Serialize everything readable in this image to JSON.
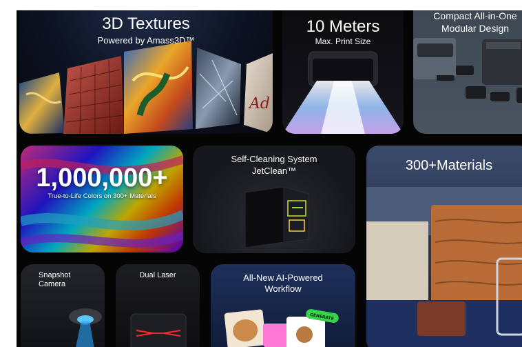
{
  "cards": {
    "textures": {
      "title": "3D Textures",
      "subtitle": "Powered by Amass3D™",
      "swatch_text": "Ad"
    },
    "meters": {
      "title": "10 Meters",
      "subtitle": "Max. Print Size"
    },
    "compact": {
      "title_line1": "Compact All-in-One",
      "title_line2": "Modular Design"
    },
    "colors": {
      "title": "1,000,000+",
      "subtitle": "True-to-Life Colors on 300+ Materials"
    },
    "jetclean": {
      "title_line1": "Self-Cleaning System",
      "title_line2": "JetClean™"
    },
    "materials": {
      "title": "300+Materials"
    },
    "snapshot": {
      "title_line1": "Snapshot",
      "title_line2": "Camera"
    },
    "laser": {
      "title": "Dual Laser"
    },
    "ai": {
      "title_line1": "All-New AI-Powered",
      "title_line2": "Workflow",
      "tag": "GENERATE"
    }
  },
  "colors": {
    "background": "#050505",
    "card_dark": "#1c1c1e",
    "tag_green": "#35d24a"
  }
}
